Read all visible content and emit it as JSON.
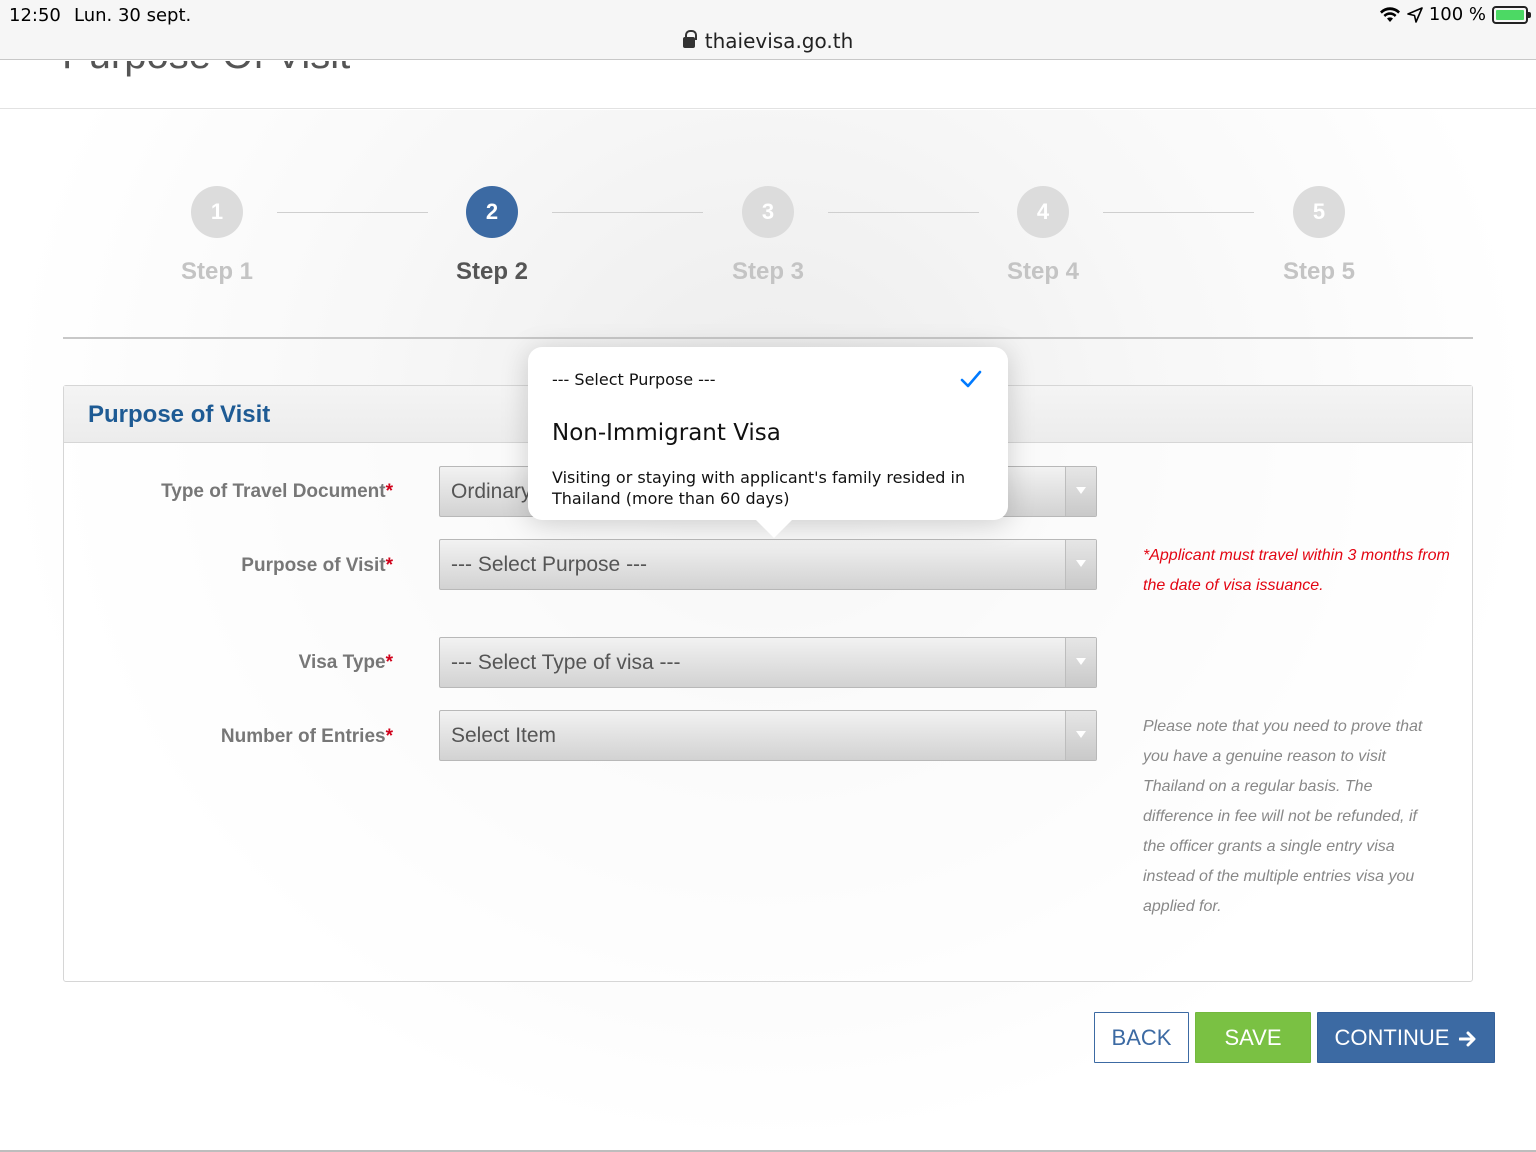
{
  "status_bar": {
    "time": "12:50",
    "date": "Lun. 30 sept.",
    "battery_text": "100 %",
    "url": "thaievisa.go.th"
  },
  "page_header": {
    "title": "Purpose Of Visit"
  },
  "steps": [
    {
      "number": "1",
      "label": "Step 1",
      "active": false
    },
    {
      "number": "2",
      "label": "Step 2",
      "active": true
    },
    {
      "number": "3",
      "label": "Step 3",
      "active": false
    },
    {
      "number": "4",
      "label": "Step 4",
      "active": false
    },
    {
      "number": "5",
      "label": "Step 5",
      "active": false
    }
  ],
  "panel": {
    "title": "Purpose of Visit"
  },
  "form": {
    "travel_document": {
      "label": "Type of Travel Document",
      "required": "*",
      "value": "Ordinary"
    },
    "purpose": {
      "label": "Purpose of Visit",
      "required": "*",
      "value": "--- Select Purpose ---"
    },
    "visa_type": {
      "label": "Visa Type",
      "required": "*",
      "value": "--- Select Type of visa ---"
    },
    "entries": {
      "label": "Number of Entries",
      "required": "*",
      "value": "Select Item"
    }
  },
  "notes": {
    "red": "*Applicant must travel within 3 months from the date of visa issuance.",
    "grey": "Please note that you need to prove that you have a genuine reason to visit Thailand on a regular basis. The difference in fee will not be refunded, if the officer grants a single entry visa instead of the multiple entries visa you applied for."
  },
  "buttons": {
    "back": "BACK",
    "save": "SAVE",
    "continue": "CONTINUE"
  },
  "popover": {
    "selected_option": "--- Select Purpose ---",
    "group_title": "Non-Immigrant Visa",
    "option_description": "Visiting or staying with applicant's family resided in Thailand (more than 60 days)"
  },
  "colors": {
    "primary": "#3c6aa3",
    "save_green": "#7ac143",
    "title_blue": "#1e5b94",
    "required_red": "#d0021b",
    "check_blue": "#007aff"
  }
}
